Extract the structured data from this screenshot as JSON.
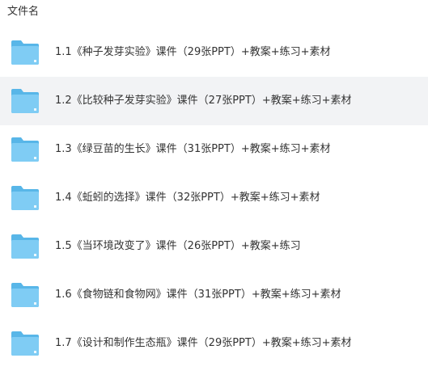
{
  "header": {
    "column_label": "文件名"
  },
  "icons": {
    "folder": "folder-icon"
  },
  "colors": {
    "folder_back": "#58b6e8",
    "folder_front": "#7fccf4",
    "selected_row_bg": "#f2f3f5"
  },
  "files": [
    {
      "name": "1.1《种子发芽实验》课件（29张PPT）+教案+练习+素材",
      "selected": false
    },
    {
      "name": "1.2《比较种子发芽实验》课件（27张PPT）+教案+练习+素材",
      "selected": true
    },
    {
      "name": "1.3《绿豆苗的生长》课件（31张PPT）+教案+练习+素材",
      "selected": false
    },
    {
      "name": "1.4《蚯蚓的选择》课件（32张PPT）+教案+练习+素材",
      "selected": false
    },
    {
      "name": "1.5《当环境改变了》课件（26张PPT）+教案+练习",
      "selected": false
    },
    {
      "name": "1.6《食物链和食物网》课件（31张PPT）+教案+练习+素材",
      "selected": false
    },
    {
      "name": "1.7《设计和制作生态瓶》课件（29张PPT）+教案+练习+素材",
      "selected": false
    }
  ]
}
